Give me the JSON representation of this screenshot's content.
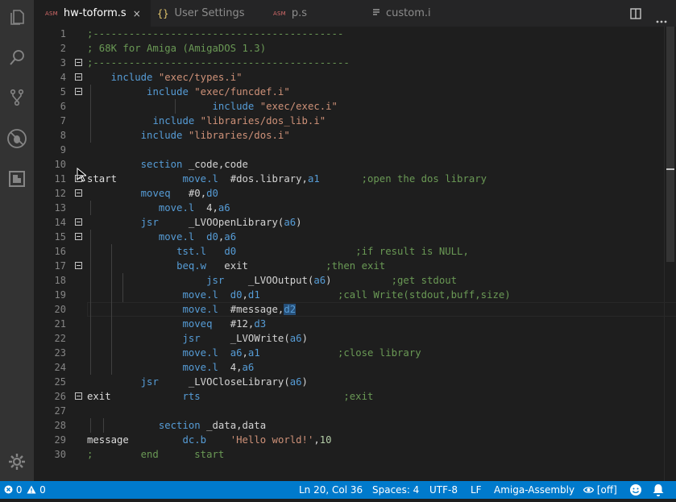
{
  "tabs": [
    {
      "label": "hw-toform.s",
      "kind": "asm",
      "badge": "ASM",
      "active": true,
      "close": "×"
    },
    {
      "label": "User Settings",
      "kind": "json",
      "badge": "{}",
      "active": false
    },
    {
      "label": "p.s",
      "kind": "asm",
      "badge": "ASM",
      "active": false
    },
    {
      "label": "custom.i",
      "kind": "lines",
      "badge": "",
      "active": false
    }
  ],
  "activity_icons": [
    "files-icon",
    "search-icon",
    "source-control-icon",
    "debug-icon",
    "extensions-icon",
    "settings-gear-icon"
  ],
  "editor": {
    "current_line": 20,
    "lines": [
      {
        "n": "1",
        "fold": false,
        "tokens": [
          [
            "c-com",
            ";------------------------------------------"
          ]
        ]
      },
      {
        "n": "2",
        "fold": false,
        "tokens": [
          [
            "c-com",
            "; 68K for Amiga (AmigaDOS 1.3)"
          ]
        ]
      },
      {
        "n": "3",
        "fold": true,
        "tokens": [
          [
            "c-com",
            ";-------------------------------------------"
          ]
        ]
      },
      {
        "n": "4",
        "fold": true,
        "tokens": [
          [
            "c-txt",
            "    "
          ],
          [
            "c-kw",
            "include"
          ],
          [
            "c-txt",
            " "
          ],
          [
            "c-str",
            "\"exec/types.i\""
          ]
        ]
      },
      {
        "n": "5",
        "fold": true,
        "tokens": [
          [
            "c-txt",
            "          "
          ],
          [
            "c-kw",
            "include"
          ],
          [
            "c-txt",
            " "
          ],
          [
            "c-str",
            "\"exec/funcdef.i\""
          ]
        ]
      },
      {
        "n": "6",
        "fold": false,
        "tokens": [
          [
            "c-txt",
            "                     "
          ],
          [
            "c-kw",
            "include"
          ],
          [
            "c-txt",
            " "
          ],
          [
            "c-str",
            "\"exec/exec.i\""
          ]
        ]
      },
      {
        "n": "7",
        "fold": false,
        "tokens": [
          [
            "c-txt",
            "           "
          ],
          [
            "c-kw",
            "include"
          ],
          [
            "c-txt",
            " "
          ],
          [
            "c-str",
            "\"libraries/dos_lib.i\""
          ]
        ]
      },
      {
        "n": "8",
        "fold": false,
        "tokens": [
          [
            "c-txt",
            "         "
          ],
          [
            "c-kw",
            "include"
          ],
          [
            "c-txt",
            " "
          ],
          [
            "c-str",
            "\"libraries/dos.i\""
          ]
        ]
      },
      {
        "n": "9",
        "fold": false,
        "tokens": []
      },
      {
        "n": "10",
        "fold": false,
        "tokens": [
          [
            "c-txt",
            "         "
          ],
          [
            "c-kw",
            "section"
          ],
          [
            "c-txt",
            " _code,code"
          ]
        ]
      },
      {
        "n": "11",
        "fold": true,
        "tokens": [
          [
            "c-lbl",
            "start"
          ],
          [
            "c-txt",
            "           "
          ],
          [
            "c-kw",
            "move.l"
          ],
          [
            "c-txt",
            "  #dos.library,"
          ],
          [
            "c-reg",
            "a1"
          ],
          [
            "c-txt",
            "       "
          ],
          [
            "c-com",
            ";open the dos library"
          ]
        ]
      },
      {
        "n": "12",
        "fold": true,
        "tokens": [
          [
            "c-txt",
            "         "
          ],
          [
            "c-kw",
            "moveq"
          ],
          [
            "c-txt",
            "   #0,"
          ],
          [
            "c-reg",
            "d0"
          ]
        ]
      },
      {
        "n": "13",
        "fold": false,
        "tokens": [
          [
            "c-txt",
            "            "
          ],
          [
            "c-kw",
            "move.l"
          ],
          [
            "c-txt",
            "  4,"
          ],
          [
            "c-reg",
            "a6"
          ]
        ]
      },
      {
        "n": "14",
        "fold": true,
        "tokens": [
          [
            "c-txt",
            "         "
          ],
          [
            "c-kw",
            "jsr"
          ],
          [
            "c-txt",
            "     _LVOOpenLibrary("
          ],
          [
            "c-reg",
            "a6"
          ],
          [
            "c-txt",
            ")"
          ]
        ]
      },
      {
        "n": "15",
        "fold": true,
        "tokens": [
          [
            "c-txt",
            "            "
          ],
          [
            "c-kw",
            "move.l"
          ],
          [
            "c-txt",
            "  "
          ],
          [
            "c-reg",
            "d0"
          ],
          [
            "c-txt",
            ","
          ],
          [
            "c-reg",
            "a6"
          ]
        ]
      },
      {
        "n": "16",
        "fold": false,
        "tokens": [
          [
            "c-txt",
            "               "
          ],
          [
            "c-kw",
            "tst.l"
          ],
          [
            "c-txt",
            "   "
          ],
          [
            "c-reg",
            "d0"
          ],
          [
            "c-txt",
            "                    "
          ],
          [
            "c-com",
            ";if result is NULL,"
          ]
        ]
      },
      {
        "n": "17",
        "fold": true,
        "tokens": [
          [
            "c-txt",
            "               "
          ],
          [
            "c-kw",
            "beq.w"
          ],
          [
            "c-txt",
            "   exit             "
          ],
          [
            "c-com",
            ";then exit"
          ]
        ]
      },
      {
        "n": "18",
        "fold": false,
        "tokens": [
          [
            "c-txt",
            "                    "
          ],
          [
            "c-kw",
            "jsr"
          ],
          [
            "c-txt",
            "    _LVOOutput("
          ],
          [
            "c-reg",
            "a6"
          ],
          [
            "c-txt",
            ")          "
          ],
          [
            "c-com",
            ";get stdout"
          ]
        ]
      },
      {
        "n": "19",
        "fold": false,
        "tokens": [
          [
            "c-txt",
            "                "
          ],
          [
            "c-kw",
            "move.l"
          ],
          [
            "c-txt",
            "  "
          ],
          [
            "c-reg",
            "d0"
          ],
          [
            "c-txt",
            ","
          ],
          [
            "c-reg",
            "d1"
          ],
          [
            "c-txt",
            "             "
          ],
          [
            "c-com",
            ";call Write(stdout,buff,size)"
          ]
        ]
      },
      {
        "n": "20",
        "fold": false,
        "tokens": [
          [
            "c-txt",
            "                "
          ],
          [
            "c-kw",
            "move.l"
          ],
          [
            "c-txt",
            "  #message,"
          ],
          [
            "c-reg sel",
            "d2"
          ]
        ]
      },
      {
        "n": "21",
        "fold": false,
        "tokens": [
          [
            "c-txt",
            "                "
          ],
          [
            "c-kw",
            "moveq"
          ],
          [
            "c-txt",
            "   #12,"
          ],
          [
            "c-reg",
            "d3"
          ]
        ]
      },
      {
        "n": "22",
        "fold": false,
        "tokens": [
          [
            "c-txt",
            "                "
          ],
          [
            "c-kw",
            "jsr"
          ],
          [
            "c-txt",
            "     _LVOWrite("
          ],
          [
            "c-reg",
            "a6"
          ],
          [
            "c-txt",
            ")"
          ]
        ]
      },
      {
        "n": "23",
        "fold": false,
        "tokens": [
          [
            "c-txt",
            "                "
          ],
          [
            "c-kw",
            "move.l"
          ],
          [
            "c-txt",
            "  "
          ],
          [
            "c-reg",
            "a6"
          ],
          [
            "c-txt",
            ","
          ],
          [
            "c-reg",
            "a1"
          ],
          [
            "c-txt",
            "             "
          ],
          [
            "c-com",
            ";close library"
          ]
        ]
      },
      {
        "n": "24",
        "fold": false,
        "tokens": [
          [
            "c-txt",
            "                "
          ],
          [
            "c-kw",
            "move.l"
          ],
          [
            "c-txt",
            "  4,"
          ],
          [
            "c-reg",
            "a6"
          ]
        ]
      },
      {
        "n": "25",
        "fold": false,
        "tokens": [
          [
            "c-txt",
            "         "
          ],
          [
            "c-kw",
            "jsr"
          ],
          [
            "c-txt",
            "     _LVOCloseLibrary("
          ],
          [
            "c-reg",
            "a6"
          ],
          [
            "c-txt",
            ")"
          ]
        ]
      },
      {
        "n": "26",
        "fold": true,
        "tokens": [
          [
            "c-lbl",
            "exit"
          ],
          [
            "c-txt",
            "            "
          ],
          [
            "c-kw",
            "rts"
          ],
          [
            "c-txt",
            "                        "
          ],
          [
            "c-com",
            ";exit"
          ]
        ]
      },
      {
        "n": "27",
        "fold": false,
        "tokens": []
      },
      {
        "n": "28",
        "fold": false,
        "tokens": [
          [
            "c-txt",
            "            "
          ],
          [
            "c-kw",
            "section"
          ],
          [
            "c-txt",
            " _data,data"
          ]
        ]
      },
      {
        "n": "29",
        "fold": false,
        "tokens": [
          [
            "c-lbl",
            "message"
          ],
          [
            "c-txt",
            "         "
          ],
          [
            "c-kw",
            "dc.b"
          ],
          [
            "c-txt",
            "    "
          ],
          [
            "c-str",
            "'Hello world!'"
          ],
          [
            "c-txt",
            ","
          ],
          [
            "c-num",
            "10"
          ]
        ]
      },
      {
        "n": "30",
        "fold": false,
        "tokens": [
          [
            "c-com",
            ";        end      start"
          ]
        ]
      }
    ]
  },
  "status": {
    "errors": "0",
    "warnings": "0",
    "position": "Ln 20, Col 36",
    "spaces": "Spaces: 4",
    "encoding": "UTF-8",
    "eol": "LF",
    "language": "Amiga-Assembly",
    "watch": "[off]"
  },
  "colors": {
    "status_bar": "#007acc",
    "activity_bar": "#333333",
    "editor_bg": "#1e1e1e",
    "tab_bar": "#252526"
  }
}
